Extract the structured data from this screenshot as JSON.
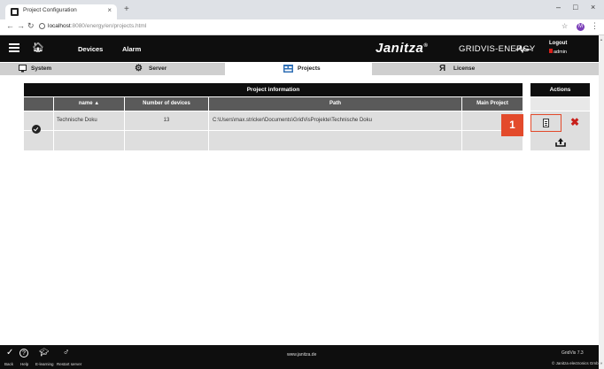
{
  "browser": {
    "tab_title": "Project Configuration",
    "tab_close": "×",
    "new_tab": "+",
    "url_host": "localhost",
    "url_rest": ":8080/energy/en/projects.html",
    "profile_initial": "M",
    "window_controls": [
      "–",
      "□",
      "×"
    ]
  },
  "header": {
    "nav": [
      "Devices",
      "Alarm"
    ],
    "brand": "Janitza",
    "brand_mark": "®",
    "brand_sub": "GRIDVIS-ENERGY",
    "logout": "Logout",
    "user": "admin"
  },
  "tabs": [
    {
      "label": "System",
      "icon": "monitor-icon"
    },
    {
      "label": "Server",
      "icon": "gear-icon"
    },
    {
      "label": "Projects",
      "icon": "projects-icon",
      "active": true
    },
    {
      "label": "License",
      "icon": "license-icon"
    }
  ],
  "table": {
    "title": "Project information",
    "actions_title": "Actions",
    "columns": [
      "name ▲",
      "Number of devices",
      "Path",
      "Main Project"
    ],
    "rows": [
      {
        "name": "Technische Doku",
        "devices": "13",
        "path": "C:\\Users\\max.stricker\\Documents\\GridVisProjekte\\Technische Doku",
        "main": true
      }
    ]
  },
  "callout": {
    "badge": "1",
    "color": "#e34a2b"
  },
  "footer": {
    "items": [
      {
        "label": "Back",
        "icon": "back-icon"
      },
      {
        "label": "Help",
        "icon": "help-icon"
      },
      {
        "label": "E-learning",
        "icon": "graduation-icon"
      },
      {
        "label": "Restart server",
        "icon": "restart-icon"
      }
    ],
    "url": "www.janitza.de",
    "version": "GridVis 7.3",
    "copyright": "© Janitza electronics GmbH"
  },
  "colors": {
    "header_bg": "#0e0e0e",
    "accent_red": "#d9201a",
    "row_bg": "#dedede",
    "col_header_bg": "#5a5a5a"
  }
}
